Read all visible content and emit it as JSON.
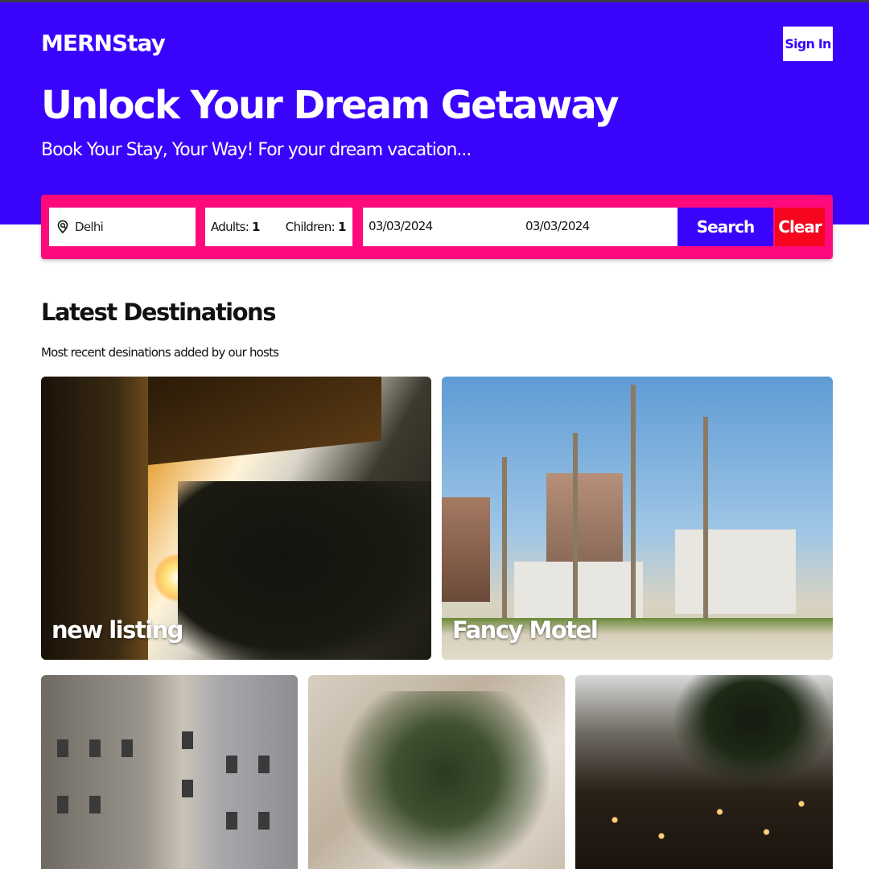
{
  "header": {
    "brand": "MERNStay",
    "sign_in_label": "Sign In",
    "headline": "Unlock Your Dream Getaway",
    "subheadline": "Book Your Stay, Your Way! For your dream vacation..."
  },
  "search": {
    "destination_value": "Delhi",
    "destination_icon": "location-search-icon",
    "adults_label": "Adults:",
    "adults_value": "1",
    "children_label": "Children:",
    "children_value": "1",
    "check_in": "03/03/2024",
    "check_out": "03/03/2024",
    "search_label": "Search",
    "clear_label": "Clear"
  },
  "colors": {
    "hero_bg": "#3a04fc",
    "search_bar_bg": "#ff0a7d",
    "search_button": "#3a04fc",
    "clear_button": "#f5061e"
  },
  "destinations": {
    "title": "Latest Destinations",
    "subtitle": "Most recent desinations added by our hosts",
    "cards": [
      {
        "name": "new listing"
      },
      {
        "name": "Fancy Motel"
      },
      {
        "name": ""
      },
      {
        "name": ""
      },
      {
        "name": ""
      }
    ]
  }
}
